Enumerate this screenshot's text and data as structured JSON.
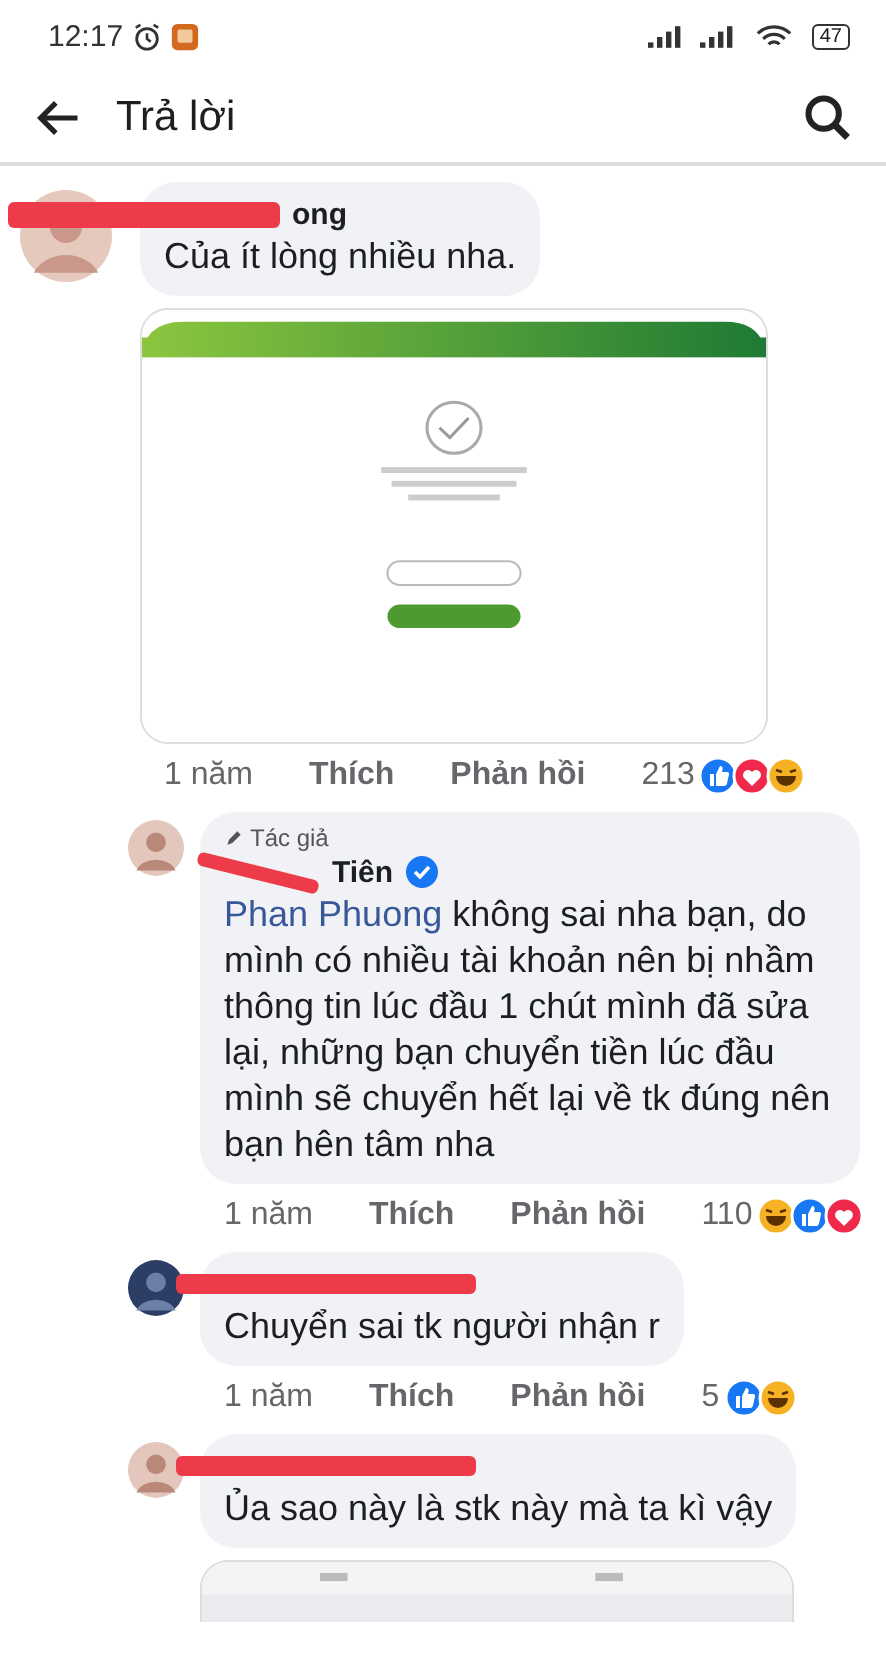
{
  "status_bar": {
    "time": "12:17",
    "battery": "47"
  },
  "header": {
    "title": "Trả lời"
  },
  "comments": [
    {
      "name": "ong",
      "name_redacted": true,
      "text": "Của ít lòng nhiều nha.",
      "time": "1 năm",
      "like": "Thích",
      "reply": "Phản hồi",
      "count": "213",
      "reactions": [
        {
          "kind": "like"
        },
        {
          "kind": "love"
        },
        {
          "kind": "haha"
        }
      ],
      "children": [
        {
          "author_label": "Tác giả",
          "name": "Tiên",
          "name_redacted": true,
          "verified": true,
          "mention": "Phan Phuong",
          "text": " không sai nha bạn, do mình có nhiều tài khoản nên bị nhầm thông tin lúc đầu 1 chút mình đã sửa lại, những bạn chuyển tiền lúc đầu mình sẽ chuyển hết lại về tk đúng nên bạn hên tâm nha",
          "time": "1 năm",
          "like": "Thích",
          "reply": "Phản hồi",
          "count": "110",
          "reactions": [
            {
              "kind": "haha"
            },
            {
              "kind": "like"
            },
            {
              "kind": "love"
            }
          ]
        },
        {
          "name_redacted": true,
          "text": "Chuyển sai tk người nhận r",
          "time": "1 năm",
          "like": "Thích",
          "reply": "Phản hồi",
          "count": "5",
          "reactions": [
            {
              "kind": "like"
            },
            {
              "kind": "haha"
            }
          ]
        },
        {
          "name_redacted": true,
          "text": "Ủa sao này là stk này mà ta kì vậy"
        }
      ]
    }
  ]
}
